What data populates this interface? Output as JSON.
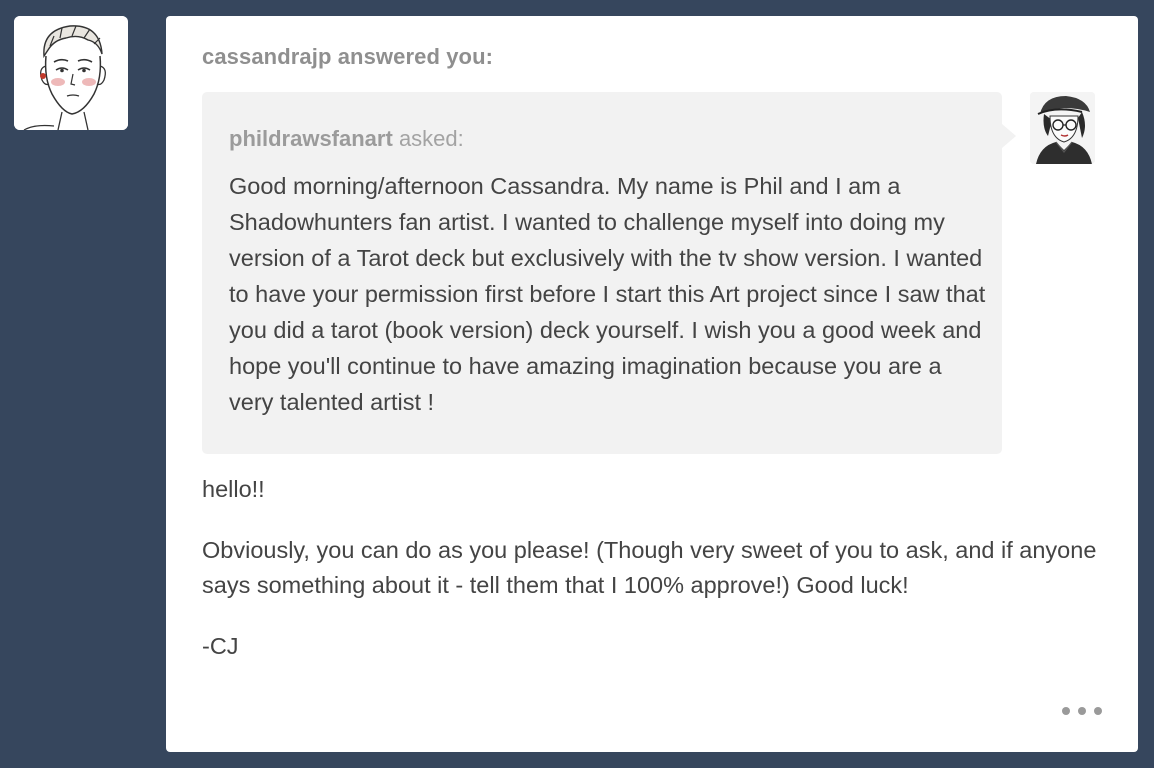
{
  "post": {
    "header": "cassandrajp answered you:",
    "ask": {
      "asker": "phildrawsfanart",
      "asked_label": "asked:",
      "question": "Good morning/afternoon Cassandra. My name is Phil and I am a Shadowhunters fan artist. I wanted to challenge myself into doing my version of a Tarot deck but exclusively with the tv show version. I wanted to have your permission first before I start this Art project since I saw that you did a tarot (book version) deck yourself. I wish you a good week and hope you'll continue to have amazing imagination because you are a very talented artist !"
    },
    "answer": {
      "greeting": "hello!!",
      "body": "Obviously, you can do as you please! (Though very sweet of you to ask, and if anyone says something about it - tell them that I 100% approve!) Good luck!",
      "signoff": "-CJ"
    }
  },
  "icons": {
    "answerer_avatar": "sketch-portrait-avatar",
    "asker_avatar": "cap-glasses-portrait-avatar",
    "more": "more-options-icon"
  },
  "colors": {
    "dashboard_bg": "#36465d",
    "card_bg": "#ffffff",
    "ask_bg": "#f2f2f2",
    "body_text": "#444444",
    "muted_text": "#8f8f8f"
  }
}
